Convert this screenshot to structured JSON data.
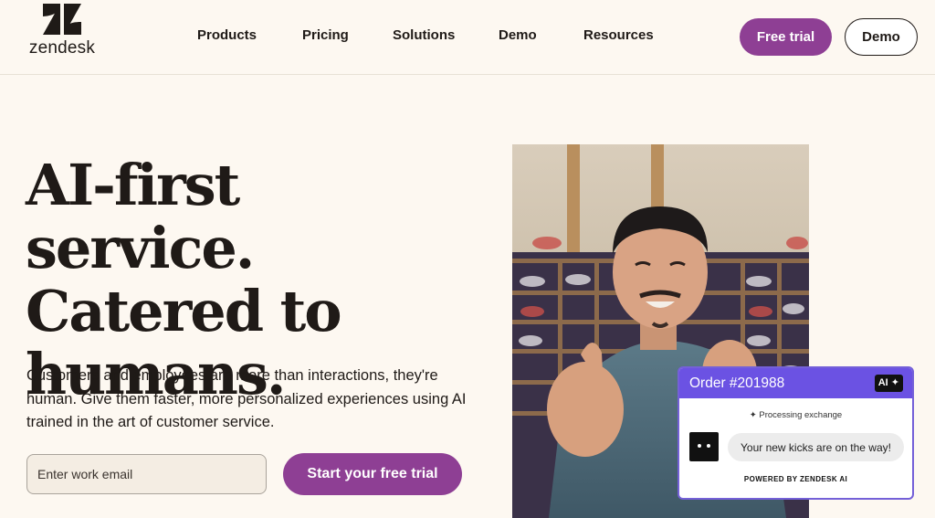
{
  "header": {
    "logo_text": "zendesk",
    "nav": [
      "Products",
      "Pricing",
      "Solutions",
      "Demo",
      "Resources"
    ],
    "free_trial_label": "Free trial",
    "demo_label": "Demo"
  },
  "hero": {
    "title_lines": [
      "AI-first service.",
      "Catered to",
      "humans."
    ],
    "subtitle": "Customers and employees are more than interactions, they're human. Give them faster, more personalized experiences using AI trained in the art of customer service.",
    "email_placeholder": "Enter work email",
    "cta_label": "Start your free trial"
  },
  "chat_card": {
    "title": "Order #201988",
    "badge": "AI",
    "status": "Processing exchange",
    "message": "Your new kicks are on the way!",
    "footer": "POWERED BY ZENDESK AI"
  },
  "colors": {
    "background": "#fdf8f1",
    "brand_purple": "#8e3f94",
    "card_header": "#6b52e3",
    "text": "#1f1a17"
  },
  "icons": [
    "zendesk-logo-icon",
    "sparkle-icon",
    "bot-avatar-icon"
  ]
}
